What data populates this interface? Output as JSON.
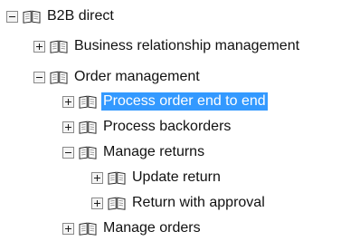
{
  "tree": {
    "nodes": [
      {
        "label": "B2B direct",
        "expanded": true,
        "icon": "book-icon"
      },
      {
        "label": "Business relationship management",
        "expanded": false,
        "icon": "book-icon"
      },
      {
        "label": "Order management",
        "expanded": true,
        "icon": "book-icon"
      },
      {
        "label": "Process order end to end",
        "expanded": false,
        "selected": true,
        "icon": "book-icon"
      },
      {
        "label": "Process backorders",
        "expanded": false,
        "icon": "book-icon"
      },
      {
        "label": "Manage returns",
        "expanded": true,
        "icon": "book-icon"
      },
      {
        "label": "Update return",
        "expanded": false,
        "icon": "book-icon"
      },
      {
        "label": "Return with approval",
        "expanded": false,
        "icon": "book-icon"
      },
      {
        "label": "Manage orders",
        "expanded": false,
        "icon": "book-icon"
      }
    ]
  },
  "colors": {
    "selection": "#3399ff",
    "text": "#111111",
    "selected_text": "#ffffff"
  }
}
